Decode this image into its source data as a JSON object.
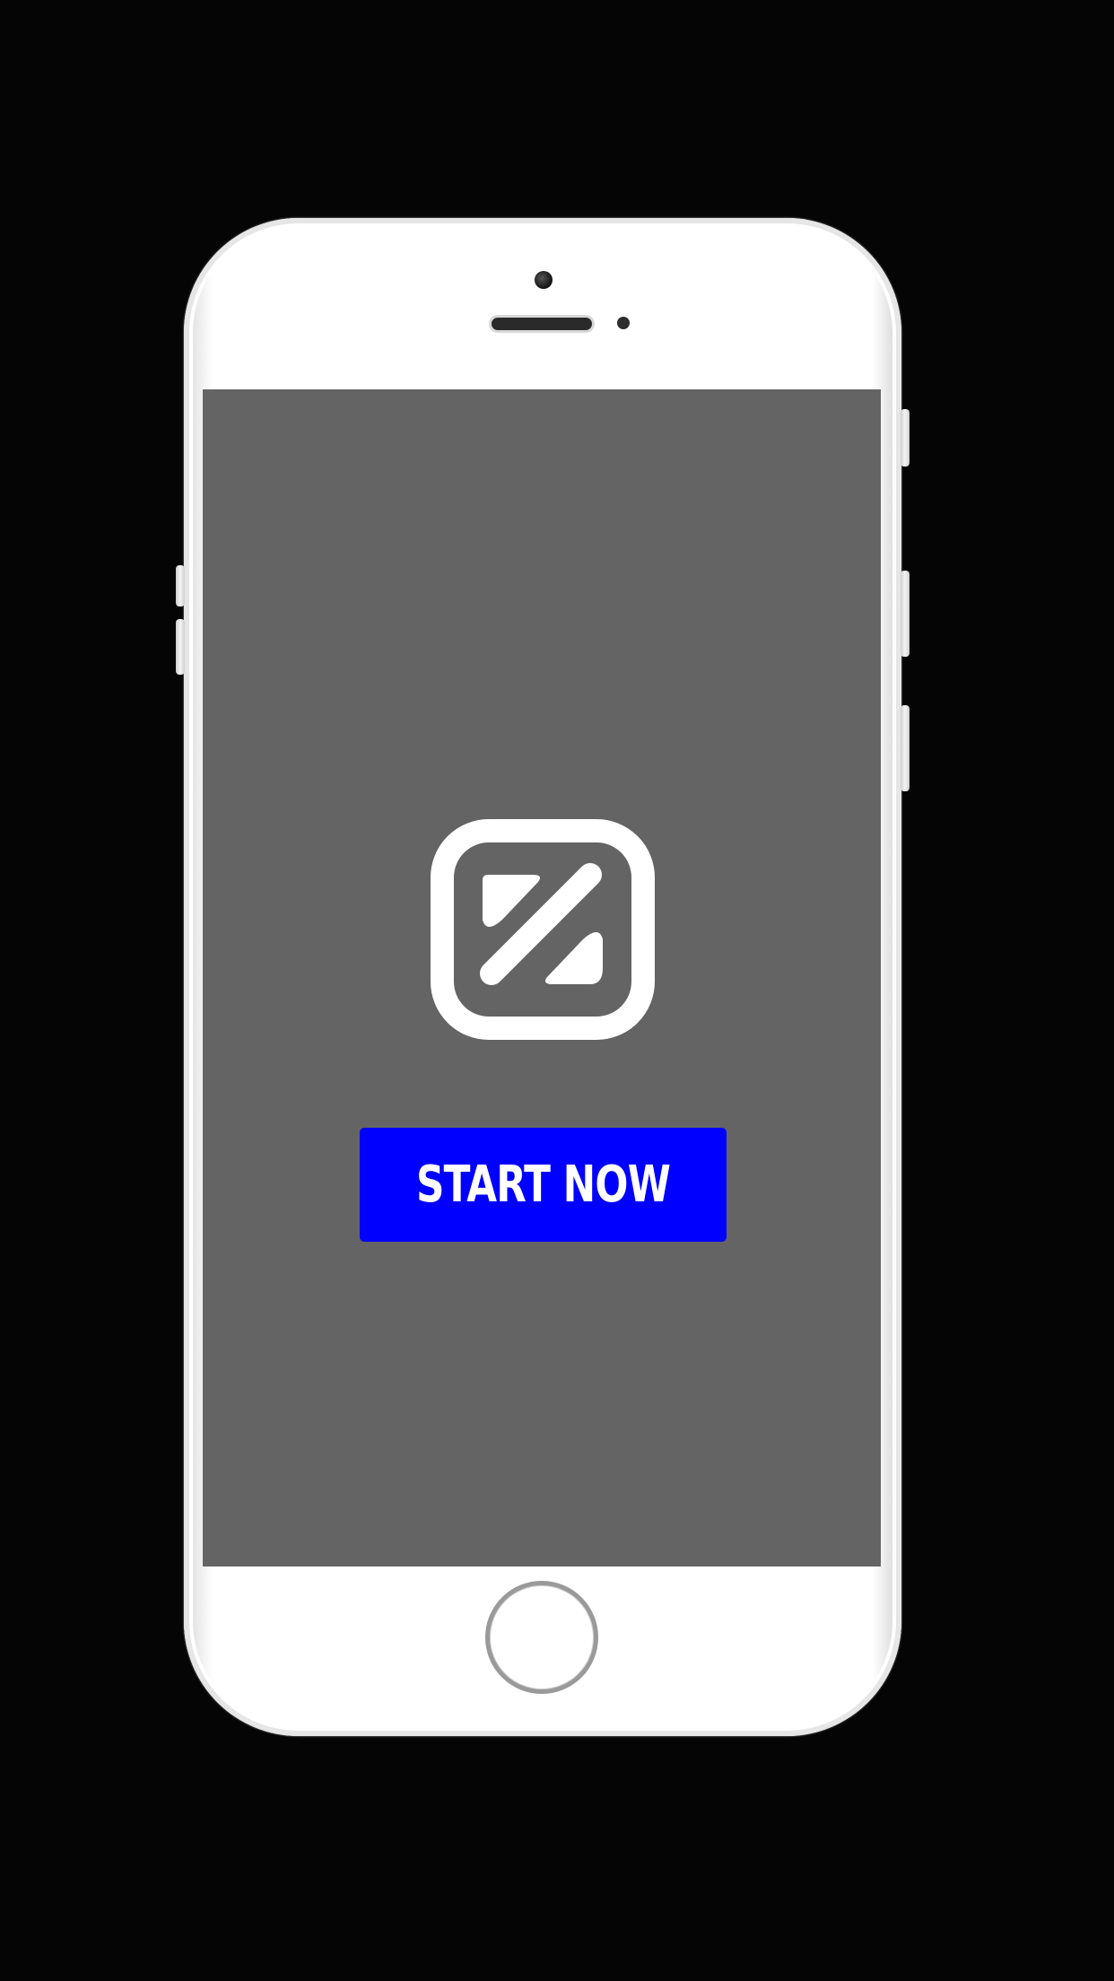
{
  "screen": {
    "logo_icon": "diagonal-split-square-icon",
    "start_button_label": "START NOW"
  },
  "colors": {
    "background": "#050505",
    "device_body": "#ffffff",
    "screen_background": "#646464",
    "accent": "#0000ff",
    "logo": "#ffffff"
  }
}
